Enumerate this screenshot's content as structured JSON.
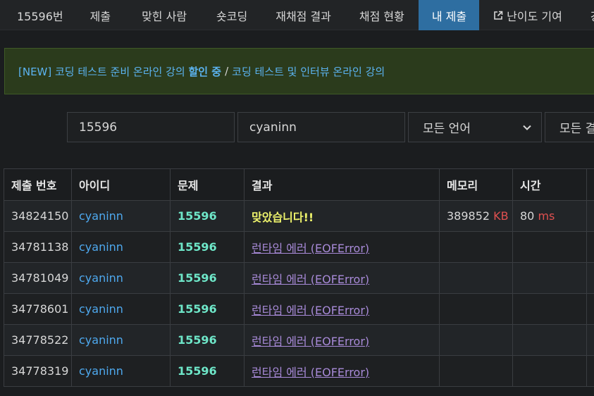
{
  "nav": {
    "items": [
      {
        "label": "15596번",
        "active": false
      },
      {
        "label": "제출",
        "active": false
      },
      {
        "label": "맞힌 사람",
        "active": false
      },
      {
        "label": "숏코딩",
        "active": false
      },
      {
        "label": "재채점 결과",
        "active": false
      },
      {
        "label": "채점 현황",
        "active": false
      },
      {
        "label": "내 제출",
        "active": true
      },
      {
        "label": "난이도 기여",
        "active": false,
        "icon": "external-link-icon"
      },
      {
        "label": "강",
        "active": false
      }
    ]
  },
  "banner": {
    "prefix": "[NEW] 코딩 테스트 준비 온라인 강의 ",
    "highlight": "할인 중",
    "separator": "/",
    "second": "코딩 테스트 및 인터뷰 온라인 강의"
  },
  "filters": {
    "problem_id": "15596",
    "user_id": "cyaninn",
    "language": "모든 언어",
    "result": "모든 결"
  },
  "table": {
    "headers": [
      "제출 번호",
      "아이디",
      "문제",
      "결과",
      "메모리",
      "시간"
    ],
    "rows": [
      {
        "submission": "34824150",
        "user": "cyaninn",
        "problem": "15596",
        "result": "맞았습니다!!",
        "result_type": "ac",
        "memory": "389852",
        "memory_unit": "KB",
        "time": "80",
        "time_unit": "ms"
      },
      {
        "submission": "34781138",
        "user": "cyaninn",
        "problem": "15596",
        "result": "런타임 에러 (EOFError)",
        "result_type": "rte",
        "memory": "",
        "memory_unit": "",
        "time": "",
        "time_unit": ""
      },
      {
        "submission": "34781049",
        "user": "cyaninn",
        "problem": "15596",
        "result": "런타임 에러 (EOFError)",
        "result_type": "rte",
        "memory": "",
        "memory_unit": "",
        "time": "",
        "time_unit": ""
      },
      {
        "submission": "34778601",
        "user": "cyaninn",
        "problem": "15596",
        "result": "런타임 에러 (EOFError)",
        "result_type": "rte",
        "memory": "",
        "memory_unit": "",
        "time": "",
        "time_unit": ""
      },
      {
        "submission": "34778522",
        "user": "cyaninn",
        "problem": "15596",
        "result": "런타임 에러 (EOFError)",
        "result_type": "rte",
        "memory": "",
        "memory_unit": "",
        "time": "",
        "time_unit": ""
      },
      {
        "submission": "34778319",
        "user": "cyaninn",
        "problem": "15596",
        "result": "런타임 에러 (EOFError)",
        "result_type": "rte",
        "memory": "",
        "memory_unit": "",
        "time": "",
        "time_unit": ""
      }
    ]
  },
  "colors": {
    "background": "#1b1d1f",
    "nav_active": "#2e6ea1",
    "banner_bg": "#2b3b1c",
    "link": "#4ea9ef",
    "problem_id": "#6ee6c8",
    "accepted": "#ecf16b",
    "runtime_error": "#a88ad8",
    "unit": "#e05050"
  }
}
